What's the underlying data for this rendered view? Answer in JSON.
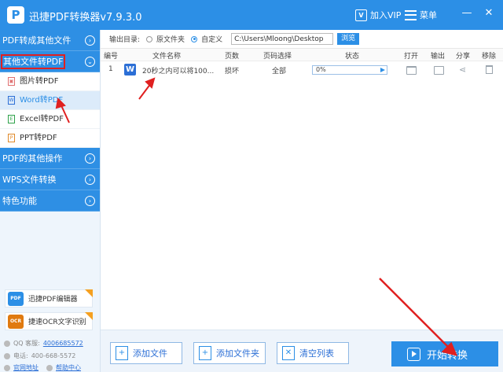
{
  "app": {
    "title": "迅捷PDF转换器v7.9.3.0",
    "logo": "P",
    "vip_label": "加入VIP",
    "vip_badge": "V",
    "menu_label": "菜单"
  },
  "window": {
    "min": "—",
    "close": "✕"
  },
  "sidebar": {
    "categories": [
      {
        "label": "PDF转成其他文件",
        "chevron": "›"
      },
      {
        "label": "其他文件转PDF",
        "chevron": "⌄"
      },
      {
        "label": "PDF的其他操作",
        "chevron": "›"
      },
      {
        "label": "WPS文件转换",
        "chevron": "›"
      },
      {
        "label": "特色功能",
        "chevron": "›"
      }
    ],
    "subitems": [
      {
        "label": "图片转PDF",
        "icon": "image-file-icon"
      },
      {
        "label": "Word转PDF",
        "icon": "word-file-icon"
      },
      {
        "label": "Excel转PDF",
        "icon": "excel-file-icon"
      },
      {
        "label": "PPT转PDF",
        "icon": "ppt-file-icon"
      }
    ],
    "promos": [
      {
        "label": "迅捷PDF编辑器",
        "icon_text": "PDF"
      },
      {
        "label": "捷速OCR文字识别",
        "icon_text": "OCR"
      }
    ],
    "qq_label": "QQ 客服:",
    "qq_number": "4006685572",
    "phone_label": "电话:",
    "phone_number": "400-668-5572",
    "site_link": "官网地址",
    "help_link": "帮助中心"
  },
  "output": {
    "label": "输出目录:",
    "option_original": "原文件夹",
    "option_custom": "自定义",
    "path": "C:\\Users\\Mloong\\Desktop",
    "browse": "浏览"
  },
  "table": {
    "headers": [
      "编号",
      "文件名称",
      "页数",
      "页码选择",
      "状态",
      "打开",
      "输出",
      "分享",
      "移除"
    ],
    "rows": [
      {
        "num": "1",
        "icon": "W",
        "name": "20秒之内可以将100...",
        "pages": "损坏",
        "range": "全部",
        "progress_text": "0%",
        "progress": 0
      }
    ]
  },
  "bottom": {
    "add_file": "添加文件",
    "add_folder": "添加文件夹",
    "clear_list": "清空列表",
    "start": "开始转换"
  },
  "colors": {
    "accent": "#2c8fe6",
    "annotation": "#e02020"
  }
}
